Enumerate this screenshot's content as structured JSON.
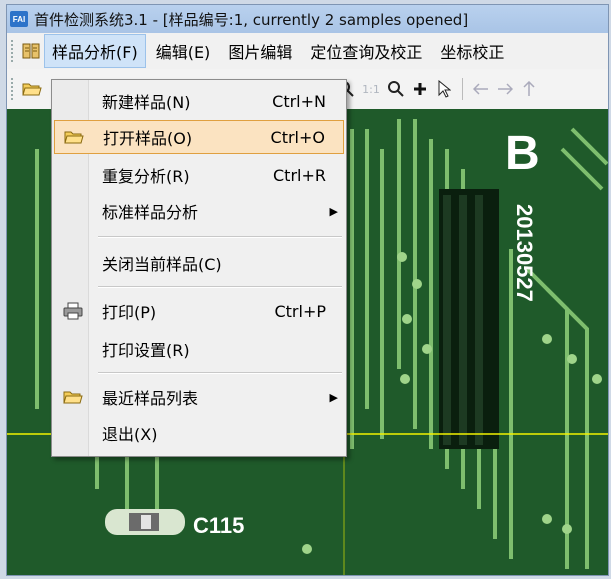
{
  "window": {
    "title": "首件检测系统3.1 - [样品编号:1, currently 2 samples opened]",
    "app_icon_text": "FAI"
  },
  "menubar": {
    "items": [
      {
        "label": "样品分析(F)"
      },
      {
        "label": "编辑(E)"
      },
      {
        "label": "图片编辑"
      },
      {
        "label": "定位查询及校正"
      },
      {
        "label": "坐标校正"
      }
    ]
  },
  "toolbar": {
    "zoom_fit_label": "1:1"
  },
  "dropdown": {
    "items": [
      {
        "label": "新建样品(N)",
        "shortcut": "Ctrl+N",
        "icon": "none"
      },
      {
        "label": "打开样品(O)",
        "shortcut": "Ctrl+O",
        "icon": "folder-open-icon"
      },
      {
        "label": "重复分析(R)",
        "shortcut": "Ctrl+R",
        "icon": "none"
      },
      {
        "label": "标准样品分析",
        "shortcut": "",
        "icon": "none",
        "submenu": true
      },
      {
        "label": "关闭当前样品(C)",
        "shortcut": "",
        "icon": "none"
      },
      {
        "label": "打印(P)",
        "shortcut": "Ctrl+P",
        "icon": "printer-icon"
      },
      {
        "label": "打印设置(R)",
        "shortcut": "",
        "icon": "none"
      },
      {
        "label": "最近样品列表",
        "shortcut": "",
        "icon": "folder-open-icon",
        "submenu": true
      },
      {
        "label": "退出(X)",
        "shortcut": "",
        "icon": "none"
      }
    ]
  },
  "board": {
    "letter": "B",
    "date_code": "20130527",
    "component_label": "C115"
  },
  "colors": {
    "board_green": "#1f5a2a",
    "trace_green": "#7fbf6a",
    "crosshair": "#f2f200",
    "highlight": "#fbe3c1"
  }
}
